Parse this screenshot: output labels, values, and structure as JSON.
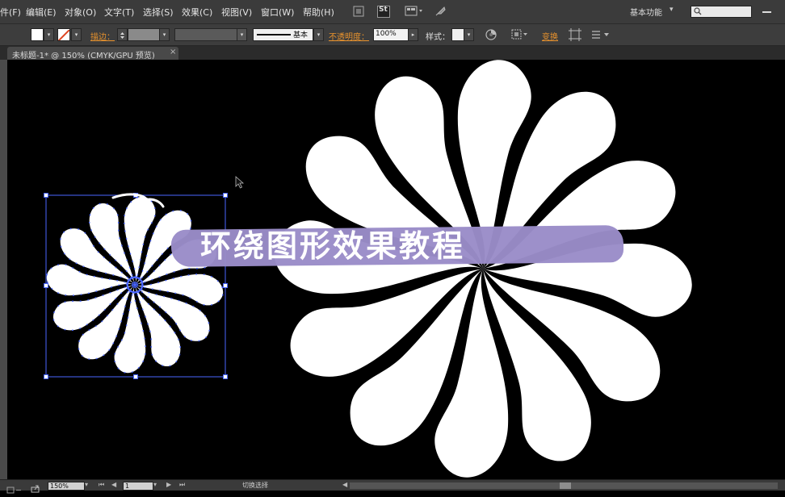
{
  "menubar": {
    "items": [
      "件(F)",
      "编辑(E)",
      "对象(O)",
      "文字(T)",
      "选择(S)",
      "效果(C)",
      "视图(V)",
      "窗口(W)",
      "帮助(H)"
    ],
    "bridge_badge": "St",
    "workspace": "基本功能",
    "search": {
      "value": "",
      "placeholder": ""
    }
  },
  "controlbar": {
    "stroke_label": "描边：",
    "stroke_style": "基本",
    "opacity_label": "不透明度：",
    "opacity_value": "100%",
    "style_label": "样式：",
    "transform_label": "变换"
  },
  "document": {
    "tab_title": "未标题-1* @ 150% (CMYK/GPU 预览)",
    "close_symbol": "×"
  },
  "banner": {
    "title": "环绕图形效果教程",
    "color": "#9a8cc8"
  },
  "statusbar": {
    "zoom": "150%",
    "page": "1",
    "status_text": "切换选择"
  },
  "colors": {
    "ui_dark": "#3b3b3b",
    "accent_orange": "#e8922d",
    "selection_blue": "#4a66ff",
    "artwork_fill": "#ffffff",
    "canvas": "#000000"
  }
}
